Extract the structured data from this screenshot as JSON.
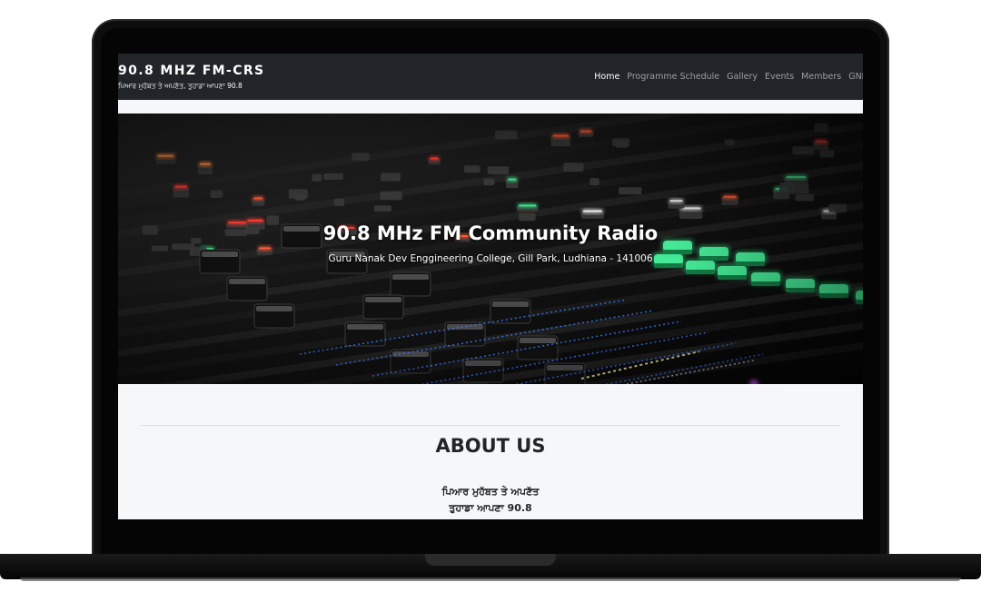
{
  "site": {
    "brand_title": "90.8 MHZ FM-CRS",
    "brand_subtitle": "ਪਿਆਰ ਮੁਹੱਬਤ ਤੇ ਅਪਣੱਤ, ਤੁਹਾਡਾ ਆਪਣਾ 90.8"
  },
  "nav": {
    "items": [
      {
        "label": "Home",
        "active": true
      },
      {
        "label": "Programme Schedule",
        "active": false
      },
      {
        "label": "Gallery",
        "active": false
      },
      {
        "label": "Events",
        "active": false
      },
      {
        "label": "Members",
        "active": false
      },
      {
        "label": "GND",
        "active": false
      }
    ]
  },
  "hero": {
    "title": "90.8 MHz FM Community Radio",
    "subtitle": "Guru Nanak Dev Enggineering College, Gill Park, Ludhiana - 141006",
    "image": "audio-mixing-console-photo"
  },
  "about": {
    "title": "ABOUT US",
    "line1": "ਪਿਆਰ ਮੁਹੱਬਤ ਤੇ ਅਪਣੱਤ",
    "line2": "ਤੁਹਾਡਾ ਆਪਣਾ 90.8"
  },
  "colors": {
    "navbar": "#212529",
    "page_bg": "#f6f7f9",
    "divider": "#e9dfb6",
    "laptop_frame": "#0d0d0d"
  }
}
